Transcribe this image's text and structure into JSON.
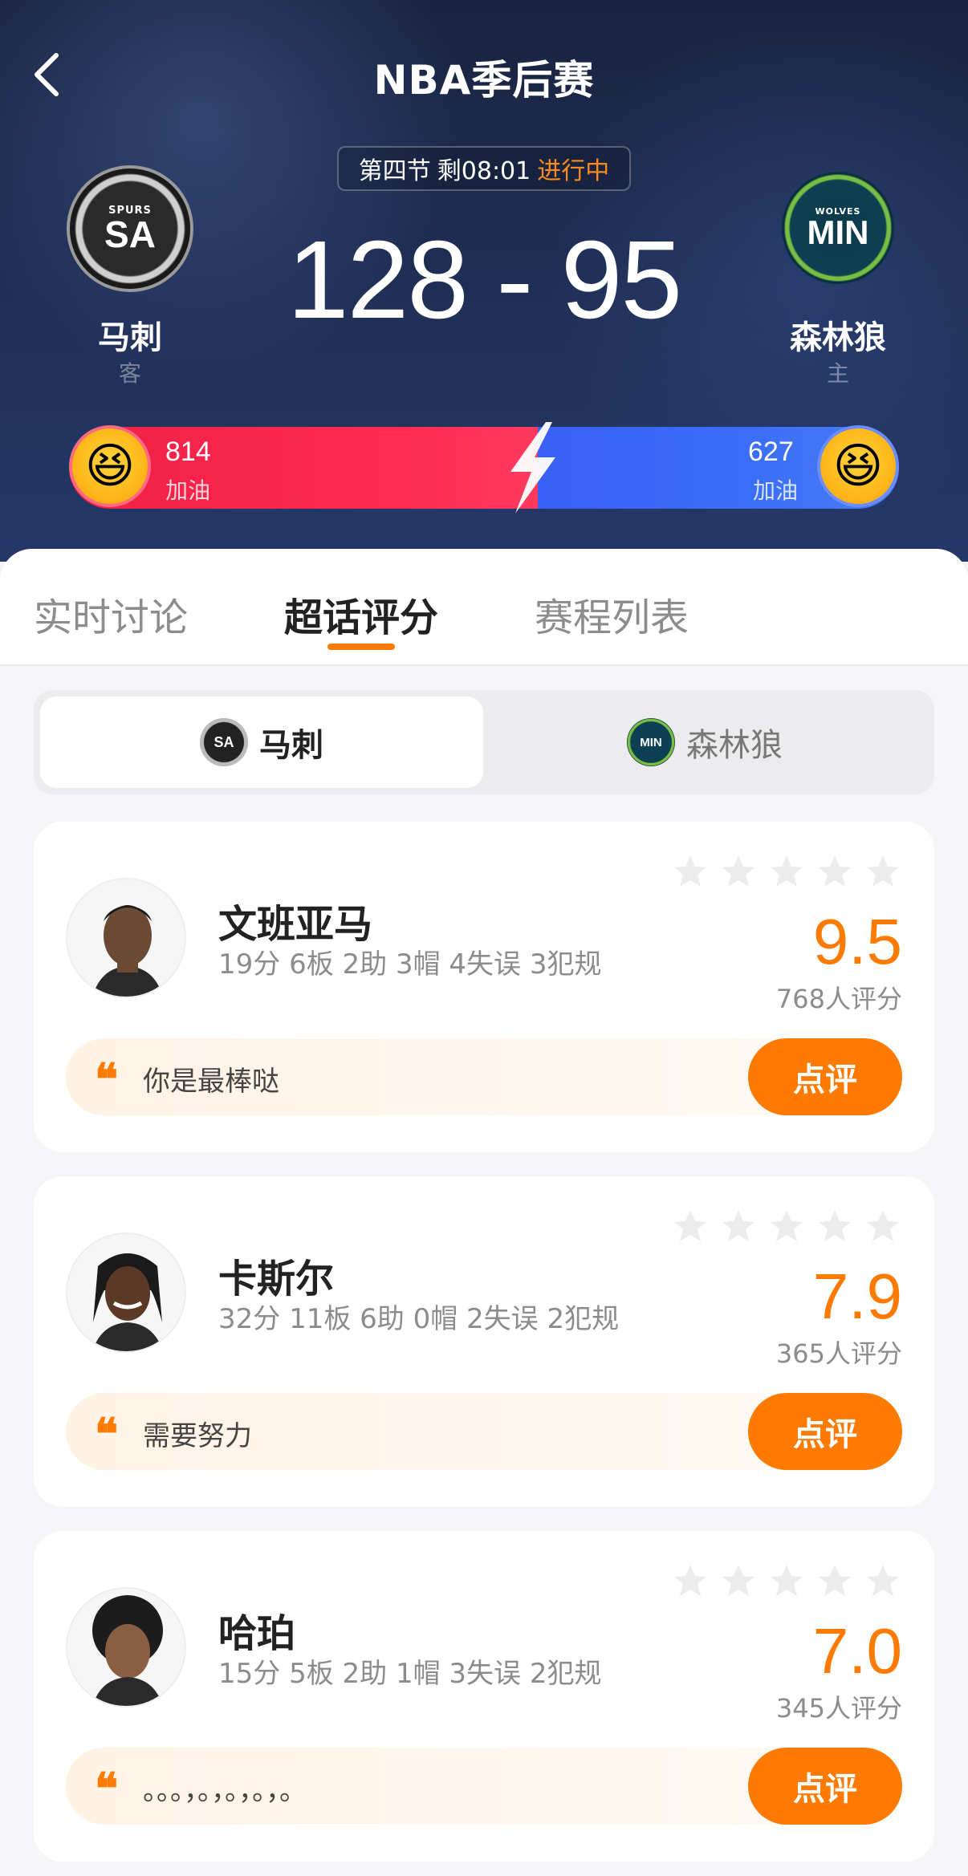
{
  "nav": {
    "title": "NBA季后赛"
  },
  "game": {
    "period": "第四节",
    "time_left": "剩08:01",
    "status": "进行中",
    "score": "128 - 95"
  },
  "away_team": {
    "name": "马刺",
    "role": "客",
    "logo_small": "SPURS",
    "logo_big": "SA"
  },
  "home_team": {
    "name": "森林狼",
    "role": "主",
    "logo_small": "WOLVES",
    "logo_big": "MIN"
  },
  "cheer": {
    "away_count": "814",
    "home_count": "627",
    "label": "加油",
    "away_share": 0.565
  },
  "tabs": [
    {
      "label": "实时讨论"
    },
    {
      "label": "超话评分"
    },
    {
      "label": "赛程列表"
    }
  ],
  "team_switch": {
    "options": [
      {
        "label": "马刺",
        "logo": "SA"
      },
      {
        "label": "森林狼",
        "logo": "MIN"
      }
    ]
  },
  "players": [
    {
      "name": "文班亚马",
      "stats": "19分 6板 2助 3帽 4失误 3犯规",
      "rating": "9.5",
      "rating_count": "768人评分",
      "comment": "你是最棒哒",
      "button": "点评"
    },
    {
      "name": "卡斯尔",
      "stats": "32分 11板 6助 0帽 2失误 2犯规",
      "rating": "7.9",
      "rating_count": "365人评分",
      "comment": "需要努力",
      "button": "点评"
    },
    {
      "name": "哈珀",
      "stats": "15分 5板 2助 1帽 3失误 2犯规",
      "rating": "7.0",
      "rating_count": "345人评分",
      "comment": "。。。，。，。，。，。",
      "button": "点评"
    }
  ],
  "colors": {
    "accent": "#ff7a00",
    "away_red": "#ff2a52",
    "home_blue": "#3b6ef8",
    "header_bg": "#1e2d52"
  },
  "icons": {
    "back": "chevron-left-icon",
    "quote": "quote-icon",
    "star": "star-icon",
    "bolt": "lightning-icon"
  }
}
